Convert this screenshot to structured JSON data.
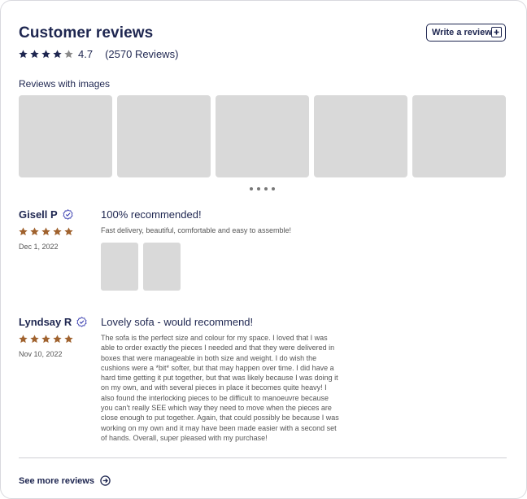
{
  "header": {
    "title": "Customer reviews",
    "write_review_label": "Write a review",
    "rating": "4.7",
    "rating_stars": 4.7,
    "review_count": "(2570 Reviews)"
  },
  "gallery": {
    "heading": "Reviews with images",
    "image_count": 5
  },
  "reviews": [
    {
      "name": "Gisell P",
      "stars": 5,
      "date": "Dec 1, 2022",
      "title": "100% recommended!",
      "body": "Fast delivery, beautiful, comfortable and easy to assemble!",
      "image_count": 2
    },
    {
      "name": "Lyndsay R",
      "stars": 5,
      "date": "Nov 10, 2022",
      "title": "Lovely sofa - would recommend!",
      "body": "The sofa is the perfect size and colour for my space. I loved that I was able to order exactly the pieces I needed and that they were delivered in boxes that were manageable in both size and weight. I do wish the cushions were a *bit* softer, but that may happen over time. I did have a hard time getting it put together, but that was likely because I was doing it on my own, and with several pieces in place it becomes quite heavy! I also found the interlocking pieces to be difficult to manoeuvre because you can't really SEE which way they need to move when the pieces are close enough to put together. Again, that could possibly be because I was working on my own and it may have been made easier with a second set of hands. Overall, super pleased with my purchase!",
      "image_count": 0
    }
  ],
  "footer": {
    "see_more_label": "See more reviews"
  },
  "colors": {
    "navy": "#1e2650",
    "review_star": "#a0622e",
    "placeholder": "#d9d9d9"
  }
}
